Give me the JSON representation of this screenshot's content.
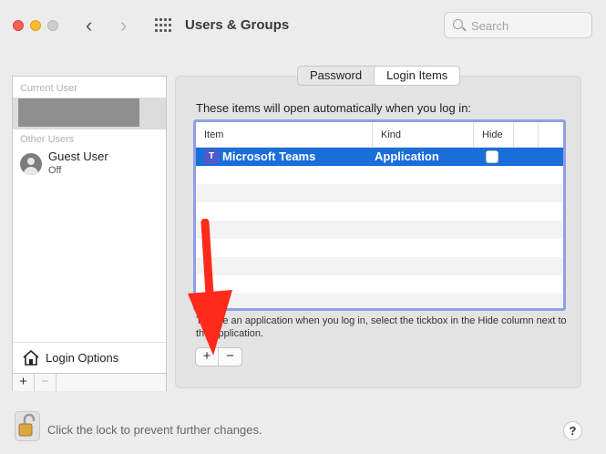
{
  "window": {
    "title": "Users & Groups"
  },
  "toolbar": {
    "search_placeholder": "Search"
  },
  "sidebar": {
    "current_user_label": "Current User",
    "other_users_label": "Other Users",
    "guest": {
      "name": "Guest User",
      "status": "Off"
    },
    "login_options": "Login Options",
    "add": "+",
    "remove": "−"
  },
  "tabs": [
    {
      "label": "Password",
      "active": false
    },
    {
      "label": "Login Items",
      "active": true
    }
  ],
  "login_items": {
    "intro": "These items will open automatically when you log in:",
    "columns": [
      "Item",
      "Kind",
      "Hide"
    ],
    "rows": [
      {
        "item": "Microsoft Teams",
        "kind": "Application",
        "hide": false,
        "selected": true
      }
    ],
    "note": "To hide an application when you log in, select the tickbox in the Hide column next to the application.",
    "add": "+",
    "remove": "−"
  },
  "footer": {
    "lock_text": "Click the lock to prevent further changes.",
    "help": "?"
  },
  "colors": {
    "selection": "#1a6ed9",
    "table_focus_ring": "#8f9fe6",
    "annotation_arrow": "#ff2a1a"
  }
}
